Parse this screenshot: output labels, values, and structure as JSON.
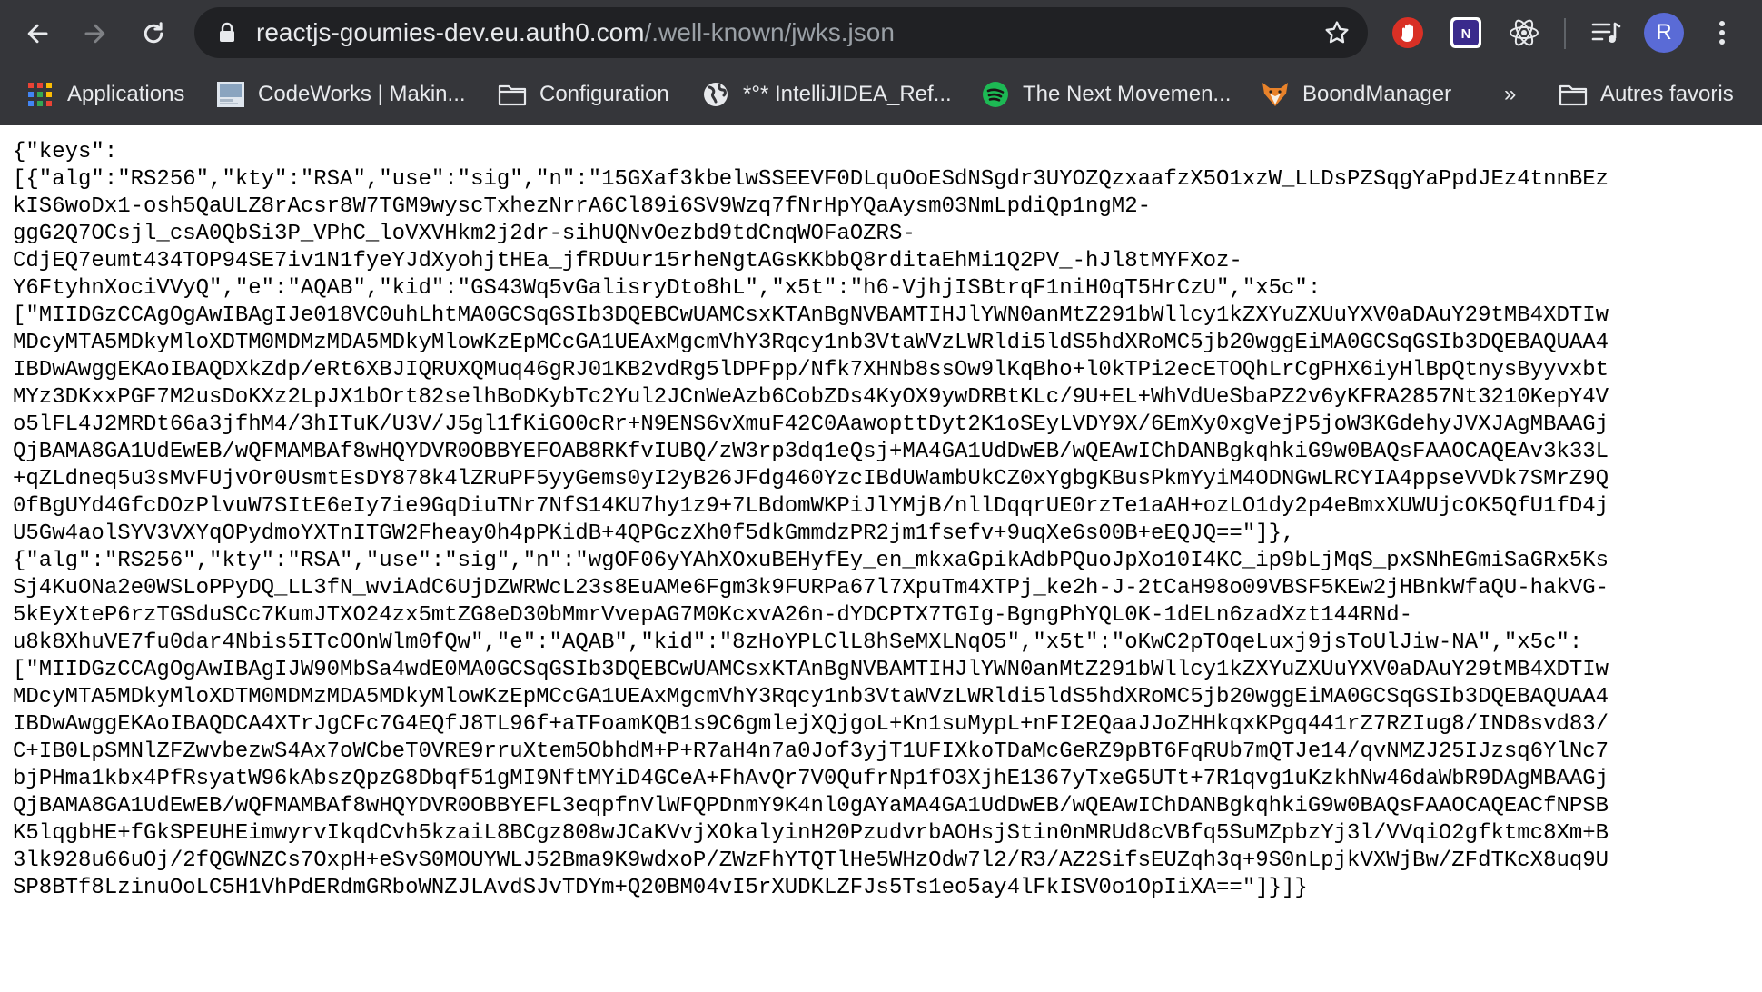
{
  "browser": {
    "url_host": "reactjs-goumies-dev.eu.auth0.com",
    "url_path": "/.well-known/jwks.json",
    "profile_initial": "R",
    "toolbar_icons": [
      "back-icon",
      "forward-icon",
      "reload-icon",
      "lock-icon",
      "star-icon",
      "extension-icon",
      "reading-list-icon",
      "more-icon"
    ],
    "colors": {
      "toolbar_bg": "#35363a",
      "omnibox_bg": "#202124",
      "avatar": "#5a6bd6",
      "text": "#e8eaed",
      "muted": "#9aa0a6"
    }
  },
  "bookmarks": {
    "items": [
      {
        "label": "Applications",
        "icon": "apps-grid-icon"
      },
      {
        "label": "CodeWorks | Makin...",
        "icon": "site-favicon"
      },
      {
        "label": "Configuration",
        "icon": "folder-icon"
      },
      {
        "label": "*°* IntelliJIDEA_Ref...",
        "icon": "globe-icon"
      },
      {
        "label": "The Next Movemen...",
        "icon": "spotify-icon"
      },
      {
        "label": "BoondManager",
        "icon": "fox-icon"
      }
    ],
    "overflow_label": "»",
    "other_label": "Autres favoris"
  },
  "json_lines": [
    "{\"keys\":",
    "[{\"alg\":\"RS256\",\"kty\":\"RSA\",\"use\":\"sig\",\"n\":\"15GXaf3kbelwSSEEVF0DLquOoESdNSgdr3UYOZQzxaafzX5O1xzW_LLDsPZSqgYaPpdJEz4tnnBEz",
    "kIS6woDx1-osh5QaULZ8rAcsr8W7TGM9wyscTxhezNrrA6Cl89i6SV9Wzq7fNrHpYQaAysm03NmLpdiQp1ngM2-",
    "ggG2Q7OCsjl_csA0QbSi3P_VPhC_loVXVHkm2j2dr-sihUQNvOezbd9tdCnqWOFaOZRS-",
    "CdjEQ7eumt434TOP94SE7iv1N1fyeYJdXyohjtHEa_jfRDUur15rheNgtAGsKKbbQ8rditaEhMi1Q2PV_-hJl8tMYFXoz-",
    "Y6FtyhnXociVVyQ\",\"e\":\"AQAB\",\"kid\":\"GS43Wq5vGalisryDto8hL\",\"x5t\":\"h6-VjhjISBtrqF1niH0qT5HrCzU\",\"x5c\":",
    "[\"MIIDGzCCAgOgAwIBAgIJe018VC0uhLhtMA0GCSqGSIb3DQEBCwUAMCsxKTAnBgNVBAMTIHJlYWN0anMtZ291bWllcy1kZXYuZXUuYXV0aDAuY29tMB4XDTIw",
    "MDcyMTA5MDkyMloXDTM0MDMzMDA5MDkyMlowKzEpMCcGA1UEAxMgcmVhY3Rqcy1nb3VtaWVzLWRldi5ldS5hdXRoMC5jb20wggEiMA0GCSqGSIb3DQEBAQUAA4",
    "IBDwAwggEKAoIBAQDXkZdp/eRt6XBJIQRUXQMuq46gRJ01KB2vdRg5lDPFpp/Nfk7XHNb8ssOw9lKqBho+l0kTPi2ecETOQhLrCgPHX6iyHlBpQtnysByyvxbt",
    "MYz3DKxxPGF7M2usDoKXz2LpJX1bOrt82selhBoDKybTc2Yul2JCnWeAzb6CobZDs4KyOX9ywDRBtKLc/9U+EL+WhVdUeSbaPZ2v6yKFRA2857Nt3210KepY4V",
    "o5lFL4J2MRDt66a3jfhM4/3hITuK/U3V/J5gl1fKiGO0cRr+N9ENS6vXmuF42C0AawopttDyt2K1oSEyLVDY9X/6EmXy0xgVejP5joW3KGdehyJVXJAgMBAAGj",
    "QjBAMA8GA1UdEwEB/wQFMAMBAf8wHQYDVR0OBBYEFOAB8RKfvIUBQ/zW3rp3dq1eQsj+MA4GA1UdDwEB/wQEAwIChDANBgkqhkiG9w0BAQsFAAOCAQEAv3k33L",
    "+qZLdneq5u3sMvFUjvOr0UsmtEsDY878k4lZRuPF5yyGems0yI2yB26JFdg460YzcIBdUWambUkCZ0xYgbgKBusPkmYyiM4ODNGwLRCYIA4ppseVVDk7SMrZ9Q",
    "0fBgUYd4GfcDOzPlvuW7SItE6eIy7ie9GqDiuTNr7NfS14KU7hy1z9+7LBdomWKPiJlYMjB/nllDqqrUE0rzTe1aAH+ozLO1dy2p4eBmxXUWUjcOK5QfU1fD4j",
    "U5Gw4aolSYV3VXYqOPydmoYXTnITGW2Fheay0h4pPKidB+4QPGczXh0f5dkGmmdzPR2jm1fsefv+9uqXe6s00B+eEQJQ==\"]},",
    "{\"alg\":\"RS256\",\"kty\":\"RSA\",\"use\":\"sig\",\"n\":\"wgOF06yYAhXOxuBEHyfEy_en_mkxaGpikAdbPQuoJpXo10I4KC_ip9bLjMqS_pxSNhEGmiSaGRx5Ks",
    "Sj4KuONa2e0WSLoPPyDQ_LL3fN_wviAdC6UjDZWRWcL23s8EuAMe6Fgm3k9FURPa67l7XpuTm4XTPj_ke2h-J-2tCaH98o09VBSF5KEw2jHBnkWfaQU-hakVG-",
    "5kEyXteP6rzTGSduSCc7KumJTXO24zx5mtZG8eD30bMmrVvepAG7M0KcxvA26n-dYDCPTX7TGIg-BgngPhYQL0K-1dELn6zadXzt144RNd-",
    "u8k8XhuVE7fu0dar4Nbis5ITcOOnWlm0fQw\",\"e\":\"AQAB\",\"kid\":\"8zHoYPLClL8hSeMXLNqO5\",\"x5t\":\"oKwC2pTOqeLuxj9jsToUlJiw-NA\",\"x5c\":",
    "[\"MIIDGzCCAgOgAwIBAgIJW90MbSa4wdE0MA0GCSqGSIb3DQEBCwUAMCsxKTAnBgNVBAMTIHJlYWN0anMtZ291bWllcy1kZXYuZXUuYXV0aDAuY29tMB4XDTIw",
    "MDcyMTA5MDkyMloXDTM0MDMzMDA5MDkyMlowKzEpMCcGA1UEAxMgcmVhY3Rqcy1nb3VtaWVzLWRldi5ldS5hdXRoMC5jb20wggEiMA0GCSqGSIb3DQEBAQUAA4",
    "IBDwAwggEKAoIBAQDCA4XTrJgCFc7G4EQfJ8TL96f+aTFoamKQB1s9C6gmlejXQjgoL+Kn1suMypL+nFI2EQaaJJoZHHkqxKPgq441rZ7RZIug8/IND8svd83/",
    "C+IB0LpSMNlZFZwvbezwS4Ax7oWCbeT0VRE9rruXtem5ObhdM+P+R7aH4n7a0Jof3yjT1UFIXkoTDaMcGeRZ9pBT6FqRUb7mQTJe14/qvNMZJ25IJzsq6YlNc7",
    "bjPHma1kbx4PfRsyatW96kAbszQpzG8Dbqf51gMI9NftMYiD4GCeA+FhAvQr7V0QufrNp1fO3XjhE1367yTxeG5UTt+7R1qvg1uKzkhNw46daWbR9DAgMBAAGj",
    "QjBAMA8GA1UdEwEB/wQFMAMBAf8wHQYDVR0OBBYEFL3eqpfnVlWFQPDnmY9K4nl0gAYaMA4GA1UdDwEB/wQEAwIChDANBgkqhkiG9w0BAQsFAAOCAQEACfNPSB",
    "K5lqgbHE+fGkSPEUHEimwyrvIkqdCvh5kzaiL8BCgz808wJCaKVvjXOkalyinH20PzudvrbAOHsjStin0nMRUd8cVBfq5SuMZpbzYj3l/VVqiO2gfktmc8Xm+B",
    "3lk928u66uOj/2fQGWNZCs7OxpH+eSvS0MOUYWLJ52Bma9K9wdxoP/ZWzFhYTQTlHe5WHzOdw7l2/R3/AZ2SifsEUZqh3q+9S0nLpjkVXWjBw/ZFdTKcX8uq9U",
    "SP8BTf8LzinuOoLC5H1VhPdERdmGRboWNZJLAvdSJvTDYm+Q20BM04vI5rXUDKLZFJs5Ts1eo5ay4lFkISV0o1OpIiXA==\"]}]}"
  ]
}
